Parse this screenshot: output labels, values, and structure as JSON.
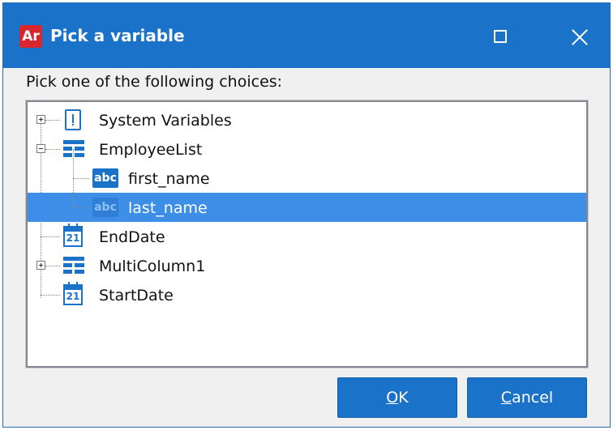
{
  "window": {
    "app_icon_text": "Ar",
    "title": "Pick a variable",
    "app_icon_color": "#d9262e",
    "accent_color": "#1a73c9"
  },
  "prompt": "Pick one of the following choices:",
  "tree": {
    "items": [
      {
        "label": "System Variables",
        "icon": "document-icon",
        "expander": "plus",
        "selected": false
      },
      {
        "label": "EmployeeList",
        "icon": "table-icon",
        "expander": "minus",
        "selected": false
      },
      {
        "label": "first_name",
        "icon": "text-variable-icon",
        "icon_text": "abc",
        "selected": false
      },
      {
        "label": "last_name",
        "icon": "text-variable-icon",
        "icon_text": "abc",
        "selected": true
      },
      {
        "label": "EndDate",
        "icon": "calendar-icon",
        "icon_text": "21",
        "selected": false
      },
      {
        "label": "MultiColumn1",
        "icon": "table-icon",
        "expander": "plus",
        "selected": false
      },
      {
        "label": "StartDate",
        "icon": "calendar-icon",
        "icon_text": "21",
        "selected": false
      }
    ],
    "selection_color": "#3d8ee6"
  },
  "buttons": {
    "ok_mnemonic": "O",
    "ok_rest": "K",
    "cancel_mnemonic": "C",
    "cancel_rest": "ancel"
  }
}
